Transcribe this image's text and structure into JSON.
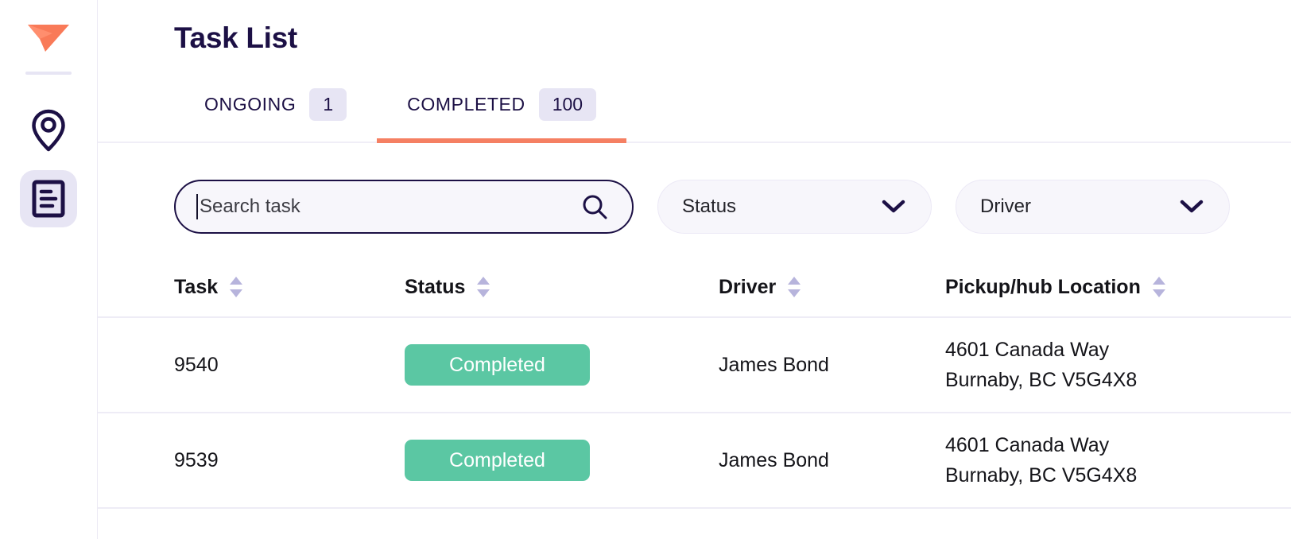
{
  "sidebar": {
    "logo_name": "paper-plane-logo",
    "items": [
      {
        "id": "map",
        "icon": "location-pin-icon",
        "active": false
      },
      {
        "id": "tasks",
        "icon": "document-list-icon",
        "active": true
      }
    ]
  },
  "header": {
    "title": "Task List"
  },
  "tabs": [
    {
      "id": "ongoing",
      "label": "ONGOING",
      "count": "1",
      "active": false
    },
    {
      "id": "completed",
      "label": "COMPLETED",
      "count": "100",
      "active": true
    }
  ],
  "filters": {
    "search": {
      "placeholder": "Search task",
      "value": "",
      "icon": "search-icon",
      "focused": true
    },
    "status_select": {
      "label": "Status",
      "icon": "chevron-down-icon"
    },
    "driver_select": {
      "label": "Driver",
      "icon": "chevron-down-icon"
    }
  },
  "table": {
    "columns": [
      {
        "id": "task",
        "label": "Task",
        "sortable": true
      },
      {
        "id": "status",
        "label": "Status",
        "sortable": true
      },
      {
        "id": "driver",
        "label": "Driver",
        "sortable": true
      },
      {
        "id": "location",
        "label": "Pickup/hub Location",
        "sortable": true
      }
    ],
    "rows": [
      {
        "task": "9540",
        "status": "Completed",
        "driver": "James Bond",
        "location_line1": "4601 Canada Way",
        "location_line2": "Burnaby, BC V5G4X8"
      },
      {
        "task": "9539",
        "status": "Completed",
        "driver": "James Bond",
        "location_line1": "4601 Canada Way",
        "location_line2": "Burnaby, BC V5G4X8"
      }
    ]
  },
  "colors": {
    "brand_coral": "#F58063",
    "deep_navy": "#1C1045",
    "badge_green": "#5BC7A3",
    "lavender_chip": "#E7E5F4",
    "field_bg": "#F7F6FB"
  }
}
